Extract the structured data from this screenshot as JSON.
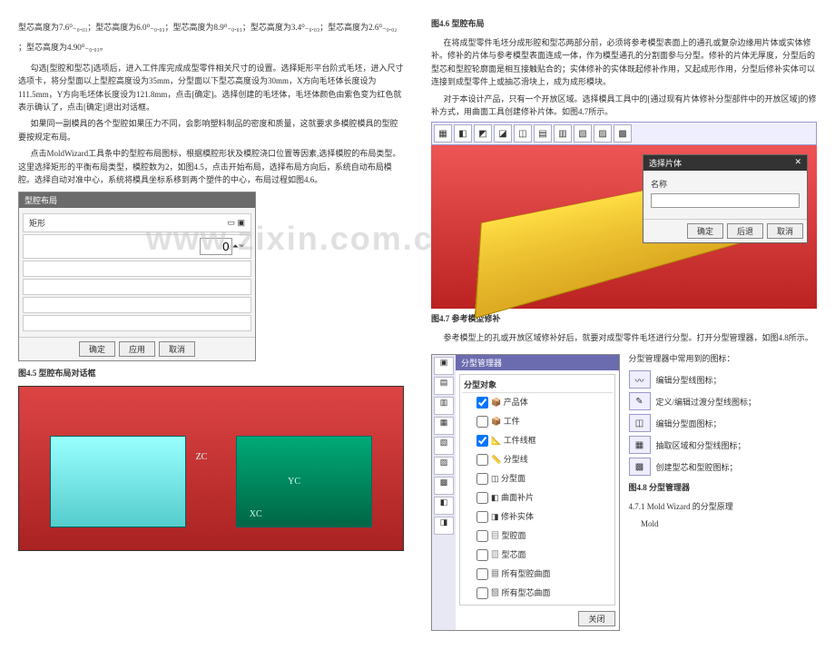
{
  "left": {
    "line1": "型芯高度为7.6⁰₋₀.₀₃；型芯高度为6.0⁰₋₀.₀₃；型芯高度为8.9⁰₋₀.₀₃；型芯高度为3.4⁰₋₀.₀₃；型芯高度为2.6⁰₋₀.₀₂",
    "line2": "；型芯高度为4.90⁰₋₀.₀₃。",
    "p1": "勾选[型腔和型芯]选项后，进入工件库完成成型零件相关尺寸的设置。选择矩形平台阶式毛坯，进入尺寸选项卡，将分型面以上型腔高度设为35mm，分型面以下型芯高度设为30mm，X方向毛坯体长度设为111.5mm，Y方向毛坯体长度设为121.8mm，点击[确定]。选择创建的毛坯体，毛坯体颜色由紫色变为红色就表示确认了，点击[确定]退出对话框。",
    "p2": "如果同一副模具的各个型腔如果压力不同，会影响塑料制品的密度和质量，这就要求多模腔模具的型腔要按规定布局。",
    "p3": "点击MoldWizard工具条中的型腔布局图标，根据模腔形状及模腔浇口位置等因素,选择模腔的布局类型。这里选择矩形的平衡布局类型，模腔数为2，如图4.5，点击开始布局，选择布局方向后，系统自动布局模腔。选择自动对准中心，系统将模具坐标系移到两个塑件的中心，布局过程如图4.6。",
    "dlg_title": "型腔布局",
    "dlg_row1": "矩形",
    "dlg_field": "0",
    "dlg_btn_ok": "确定",
    "dlg_btn_apply": "应用",
    "dlg_btn_cancel": "取消",
    "cap5": "图4.5 型腔布局对话框",
    "render_lab_zc": "ZC",
    "render_lab_yc": "YC",
    "render_lab_xc": "XC"
  },
  "right": {
    "cap6": "图4.6 型腔布局",
    "p1": "在将成型零件毛坯分成形腔和型芯两部分前，必须将参考模型表面上的通孔或复杂边缘用片体或实体修补。修补的片体与参考模型表面连成一体，作为模型通孔的分割面参与分型。修补的片体无厚度，分型后的型芯和型腔轮廓面是相互接触贴合的；实体修补的实体既起修补作用，又起成形作用，分型后修补实体可以连接到成型零件上或抽芯滑块上，成为成形模块。",
    "p2": "对于本设计产品，只有一个开放区域。选择模具工具中的[通过现有片体修补分型部件中的开放区域]的修补方式，用曲面工具创建修补片体。如图4.7所示。",
    "small_title": "选择片体",
    "small_lbl": "名称",
    "small_ok": "确定",
    "small_back": "后退",
    "small_cancel": "取消",
    "cap7": "图4.7 参考模型修补",
    "p3": "参考模型上的孔或开放区域修补好后，就要对成型零件毛坯进行分型。打开分型管理器，如图4.8所示。",
    "intro_icons": "分型管理器中常用到的图标：",
    "icon1": "编辑分型线图标；",
    "icon2": "定义/编辑过渡分型线图标；",
    "icon3": "编辑分型面图标；",
    "icon4": "抽取区域和分型线图标；",
    "icon5": "创建型芯和型腔图标；",
    "tree_title": "分型管理器",
    "tree_header": "分型对象",
    "tree_items": [
      "产品体",
      "工件",
      "工件线框",
      "分型线",
      "分型面",
      "曲面补片",
      "修补实体",
      "型腔面",
      "型芯面",
      "所有型腔曲面",
      "所有型芯曲面"
    ],
    "tree_close": "关闭",
    "cap8": "图4.8 分型管理器",
    "sec_heading": "4.7.1 Mold Wizard 的分型原理",
    "sec_word": "Mold"
  },
  "watermark": "www.zixin.com.cn"
}
